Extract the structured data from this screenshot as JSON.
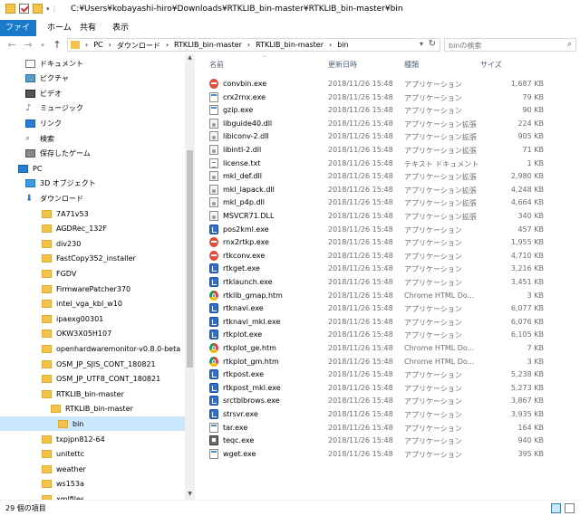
{
  "window": {
    "title": "C:¥Users¥kobayashi-hiro¥Downloads¥RTKLIB_bin-master¥RTKLIB_bin-master¥bin"
  },
  "ribbon": {
    "tabs": [
      "ファイル",
      "ホーム",
      "共有",
      "表示"
    ]
  },
  "address": {
    "crumbs": [
      "PC",
      "ダウンロード",
      "RTKLIB_bin-master",
      "RTKLIB_bin-master",
      "bin"
    ],
    "search_placeholder": "binの検索"
  },
  "nav_tree": [
    {
      "label": "ドキュメント",
      "icon": "doc",
      "indent": 0
    },
    {
      "label": "ピクチャ",
      "icon": "pic",
      "indent": 0
    },
    {
      "label": "ビデオ",
      "icon": "vid",
      "indent": 0
    },
    {
      "label": "ミュージック",
      "icon": "music",
      "indent": 0
    },
    {
      "label": "リンク",
      "icon": "link",
      "indent": 0
    },
    {
      "label": "検索",
      "icon": "search",
      "indent": 0
    },
    {
      "label": "保存したゲーム",
      "icon": "game",
      "indent": 0
    },
    {
      "label": "PC",
      "icon": "pc",
      "indent": -1
    },
    {
      "label": "3D オブジェクト",
      "icon": "obj3d",
      "indent": 0
    },
    {
      "label": "ダウンロード",
      "icon": "dl",
      "indent": 0
    },
    {
      "label": "7A71v53",
      "icon": "folder",
      "indent": 1
    },
    {
      "label": "AGDRec_132F",
      "icon": "folder",
      "indent": 1
    },
    {
      "label": "div230",
      "icon": "folder",
      "indent": 1
    },
    {
      "label": "FastCopy352_installer",
      "icon": "folder",
      "indent": 1
    },
    {
      "label": "FGDV",
      "icon": "folder",
      "indent": 1
    },
    {
      "label": "FirmwarePatcher370",
      "icon": "folder",
      "indent": 1
    },
    {
      "label": "intel_vga_kbl_w10",
      "icon": "folder",
      "indent": 1
    },
    {
      "label": "ipaexg00301",
      "icon": "folder",
      "indent": 1
    },
    {
      "label": "OKW3X05H107",
      "icon": "folder",
      "indent": 1
    },
    {
      "label": "openhardwaremonitor-v0.8.0-beta",
      "icon": "folder",
      "indent": 1
    },
    {
      "label": "OSM_JP_SJIS_CONT_180821",
      "icon": "folder",
      "indent": 1
    },
    {
      "label": "OSM_JP_UTF8_CONT_180821",
      "icon": "folder",
      "indent": 1
    },
    {
      "label": "RTKLIB_bin-master",
      "icon": "folder",
      "indent": 1
    },
    {
      "label": "RTKLIB_bin-master",
      "icon": "folder",
      "indent": 2
    },
    {
      "label": "bin",
      "icon": "folder",
      "indent": 3,
      "selected": true
    },
    {
      "label": "txpjpn812-64",
      "icon": "folder",
      "indent": 1
    },
    {
      "label": "unitettc",
      "icon": "folder",
      "indent": 1
    },
    {
      "label": "weather",
      "icon": "folder",
      "indent": 1
    },
    {
      "label": "ws153a",
      "icon": "folder",
      "indent": 1
    },
    {
      "label": "xmlfiles",
      "icon": "folder",
      "indent": 1
    }
  ],
  "columns": {
    "name": "名前",
    "date": "更新日時",
    "type": "種類",
    "size": "サイズ"
  },
  "files": [
    {
      "name": "convbin.exe",
      "date": "2018/11/26 15:48",
      "type": "アプリケーション",
      "size": "1,687 KB",
      "icon": "red"
    },
    {
      "name": "crx2rnx.exe",
      "date": "2018/11/26 15:48",
      "type": "アプリケーション",
      "size": "79 KB",
      "icon": "exe"
    },
    {
      "name": "gzip.exe",
      "date": "2018/11/26 15:48",
      "type": "アプリケーション",
      "size": "90 KB",
      "icon": "exe"
    },
    {
      "name": "libguide40.dll",
      "date": "2018/11/26 15:48",
      "type": "アプリケーション拡張",
      "size": "224 KB",
      "icon": "dll"
    },
    {
      "name": "libiconv-2.dll",
      "date": "2018/11/26 15:48",
      "type": "アプリケーション拡張",
      "size": "905 KB",
      "icon": "dll"
    },
    {
      "name": "libintl-2.dll",
      "date": "2018/11/26 15:48",
      "type": "アプリケーション拡張",
      "size": "71 KB",
      "icon": "dll"
    },
    {
      "name": "license.txt",
      "date": "2018/11/26 15:48",
      "type": "テキスト ドキュメント",
      "size": "1 KB",
      "icon": "txt"
    },
    {
      "name": "mkl_def.dll",
      "date": "2018/11/26 15:48",
      "type": "アプリケーション拡張",
      "size": "2,980 KB",
      "icon": "dll"
    },
    {
      "name": "mkl_lapack.dll",
      "date": "2018/11/26 15:48",
      "type": "アプリケーション拡張",
      "size": "4,248 KB",
      "icon": "dll"
    },
    {
      "name": "mkl_p4p.dll",
      "date": "2018/11/26 15:48",
      "type": "アプリケーション拡張",
      "size": "4,664 KB",
      "icon": "dll"
    },
    {
      "name": "MSVCR71.DLL",
      "date": "2018/11/26 15:48",
      "type": "アプリケーション拡張",
      "size": "340 KB",
      "icon": "dll"
    },
    {
      "name": "pos2kml.exe",
      "date": "2018/11/26 15:48",
      "type": "アプリケーション",
      "size": "457 KB",
      "icon": "blue"
    },
    {
      "name": "rnx2rtkp.exe",
      "date": "2018/11/26 15:48",
      "type": "アプリケーション",
      "size": "1,955 KB",
      "icon": "red"
    },
    {
      "name": "rtkconv.exe",
      "date": "2018/11/26 15:48",
      "type": "アプリケーション",
      "size": "4,710 KB",
      "icon": "red"
    },
    {
      "name": "rtkget.exe",
      "date": "2018/11/26 15:48",
      "type": "アプリケーション",
      "size": "3,216 KB",
      "icon": "blue"
    },
    {
      "name": "rtklaunch.exe",
      "date": "2018/11/26 15:48",
      "type": "アプリケーション",
      "size": "3,451 KB",
      "icon": "blue"
    },
    {
      "name": "rtklib_gmap.htm",
      "date": "2018/11/26 15:48",
      "type": "Chrome HTML Do...",
      "size": "3 KB",
      "icon": "chrome"
    },
    {
      "name": "rtknavi.exe",
      "date": "2018/11/26 15:48",
      "type": "アプリケーション",
      "size": "6,077 KB",
      "icon": "blue"
    },
    {
      "name": "rtknavi_mkl.exe",
      "date": "2018/11/26 15:48",
      "type": "アプリケーション",
      "size": "6,076 KB",
      "icon": "blue"
    },
    {
      "name": "rtkplot.exe",
      "date": "2018/11/26 15:48",
      "type": "アプリケーション",
      "size": "6,105 KB",
      "icon": "blue"
    },
    {
      "name": "rtkplot_ge.htm",
      "date": "2018/11/26 15:48",
      "type": "Chrome HTML Do...",
      "size": "7 KB",
      "icon": "chrome"
    },
    {
      "name": "rtkplot_gm.htm",
      "date": "2018/11/26 15:48",
      "type": "Chrome HTML Do...",
      "size": "3 KB",
      "icon": "chrome"
    },
    {
      "name": "rtkpost.exe",
      "date": "2018/11/26 15:48",
      "type": "アプリケーション",
      "size": "5,238 KB",
      "icon": "blue"
    },
    {
      "name": "rtkpost_mkl.exe",
      "date": "2018/11/26 15:48",
      "type": "アプリケーション",
      "size": "5,273 KB",
      "icon": "blue"
    },
    {
      "name": "srctblbrows.exe",
      "date": "2018/11/26 15:48",
      "type": "アプリケーション",
      "size": "3,867 KB",
      "icon": "blue"
    },
    {
      "name": "strsvr.exe",
      "date": "2018/11/26 15:48",
      "type": "アプリケーション",
      "size": "3,935 KB",
      "icon": "blue"
    },
    {
      "name": "tar.exe",
      "date": "2018/11/26 15:48",
      "type": "アプリケーション",
      "size": "164 KB",
      "icon": "exe"
    },
    {
      "name": "teqc.exe",
      "date": "2018/11/26 15:48",
      "type": "アプリケーション",
      "size": "940 KB",
      "icon": "grey"
    },
    {
      "name": "wget.exe",
      "date": "2018/11/26 15:48",
      "type": "アプリケーション",
      "size": "395 KB",
      "icon": "exe"
    }
  ],
  "status": {
    "count_text": "29 個の項目"
  }
}
